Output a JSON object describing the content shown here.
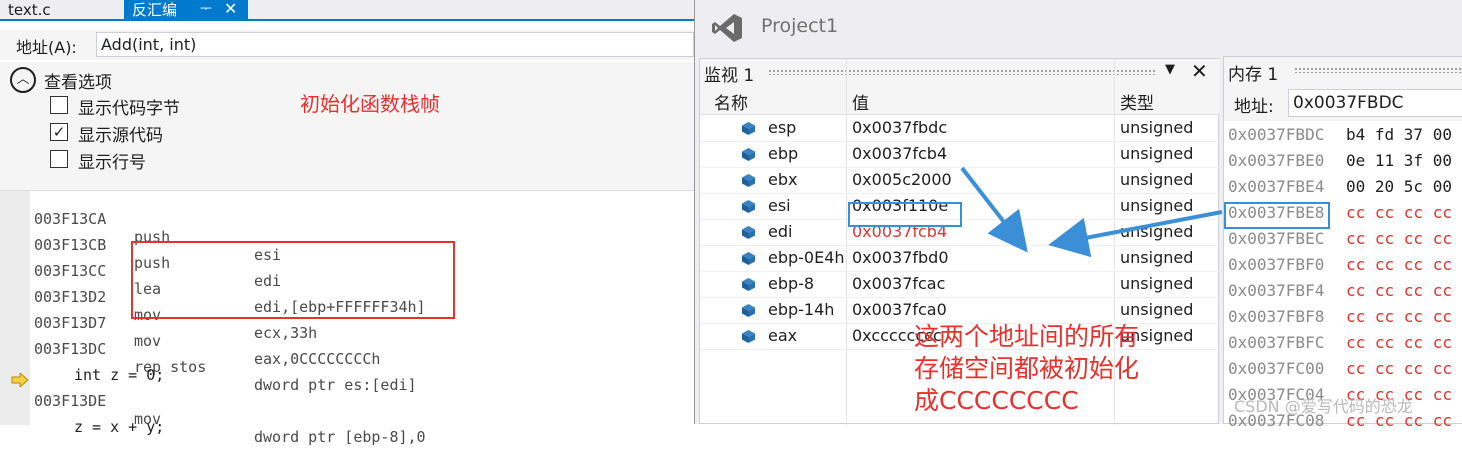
{
  "tabs": {
    "file": "text.c",
    "disasm": "反汇编",
    "pin": "ᅮ",
    "close": "✕"
  },
  "address_bar": {
    "label": "地址(A):",
    "value": "Add(int, int)"
  },
  "view_options": {
    "title": "查看选项",
    "items": [
      {
        "label": "显示代码字节",
        "checked": false
      },
      {
        "label": "显示源代码",
        "checked": true
      },
      {
        "label": "显示行号",
        "checked": false
      }
    ]
  },
  "annotation_top": "初始化函数栈帧",
  "code_lines": [
    {
      "addr": "003F13CA",
      "op": "push",
      "arg": "esi"
    },
    {
      "addr": "003F13CB",
      "op": "push",
      "arg": "edi"
    },
    {
      "addr": "003F13CC",
      "op": "lea",
      "arg": "edi,[ebp+FFFFFF34h]"
    },
    {
      "addr": "003F13D2",
      "op": "mov",
      "arg": "ecx,33h"
    },
    {
      "addr": "003F13D7",
      "op": "mov",
      "arg": "eax,0CCCCCCCCh"
    },
    {
      "addr": "003F13DC",
      "op": "rep stos",
      "arg": "dword ptr es:[edi]"
    },
    {
      "src": "int z = 0;"
    },
    {
      "addr": "003F13DE",
      "op": "mov",
      "arg": "dword ptr [ebp-8],0"
    },
    {
      "src": "z = x + y;"
    }
  ],
  "project": {
    "title": "Project1"
  },
  "watch": {
    "title": "监视 1",
    "columns": {
      "name": "名称",
      "value": "值",
      "type": "类型"
    },
    "rows": [
      {
        "name": "esp",
        "value": "0x0037fbdc",
        "type": "unsigned",
        "changed": false
      },
      {
        "name": "ebp",
        "value": "0x0037fcb4",
        "type": "unsigned",
        "changed": false
      },
      {
        "name": "ebx",
        "value": "0x005c2000",
        "type": "unsigned",
        "changed": false
      },
      {
        "name": "esi",
        "value": "0x003f110e",
        "type": "unsigned",
        "changed": false
      },
      {
        "name": "edi",
        "value": "0x0037fcb4",
        "type": "unsigned",
        "changed": true
      },
      {
        "name": "ebp-0E4h",
        "value": "0x0037fbd0",
        "type": "unsigned",
        "changed": false
      },
      {
        "name": "ebp-8",
        "value": "0x0037fcac",
        "type": "unsigned",
        "changed": false
      },
      {
        "name": "ebp-14h",
        "value": "0x0037fca0",
        "type": "unsigned",
        "changed": false
      },
      {
        "name": "eax",
        "value": "0xcccccccc",
        "type": "unsigned",
        "changed": false
      }
    ]
  },
  "annotation_mid": [
    "这两个地址间的所有",
    "存储空间都被初始化",
    "成CCCCCCCC"
  ],
  "memory": {
    "title": "内存 1",
    "address_label": "地址:",
    "address_value": "0x0037FBDC",
    "rows": [
      {
        "addr": "0x0037FBDC",
        "bytes": "b4 fd 37 00",
        "changed": false
      },
      {
        "addr": "0x0037FBE0",
        "bytes": "0e 11 3f 00",
        "changed": false
      },
      {
        "addr": "0x0037FBE4",
        "bytes": "00 20 5c 00",
        "changed": false
      },
      {
        "addr": "0x0037FBE8",
        "bytes": "cc cc cc cc",
        "changed": true
      },
      {
        "addr": "0x0037FBEC",
        "bytes": "cc cc cc cc",
        "changed": true
      },
      {
        "addr": "0x0037FBF0",
        "bytes": "cc cc cc cc",
        "changed": true
      },
      {
        "addr": "0x0037FBF4",
        "bytes": "cc cc cc cc",
        "changed": true
      },
      {
        "addr": "0x0037FBF8",
        "bytes": "cc cc cc cc",
        "changed": true
      },
      {
        "addr": "0x0037FBFC",
        "bytes": "cc cc cc cc",
        "changed": true
      },
      {
        "addr": "0x0037FC00",
        "bytes": "cc cc cc cc",
        "changed": true
      },
      {
        "addr": "0x0037FC04",
        "bytes": "cc cc cc cc",
        "changed": true
      },
      {
        "addr": "0x0037FC08",
        "bytes": "cc cc cc cc",
        "changed": true
      }
    ]
  },
  "watermark": "CSDN @爱写代码的恐龙",
  "colors": {
    "accent": "#007acc",
    "annotation": "#e8302d",
    "highlight_box": "#3b8fd6",
    "changed_value": "#e8302d"
  },
  "icons": {
    "toggle": "collapse-up-icon",
    "variable": "cube-icon",
    "exec_pointer": "arrow-right-icon",
    "logo": "visual-studio-logo"
  }
}
